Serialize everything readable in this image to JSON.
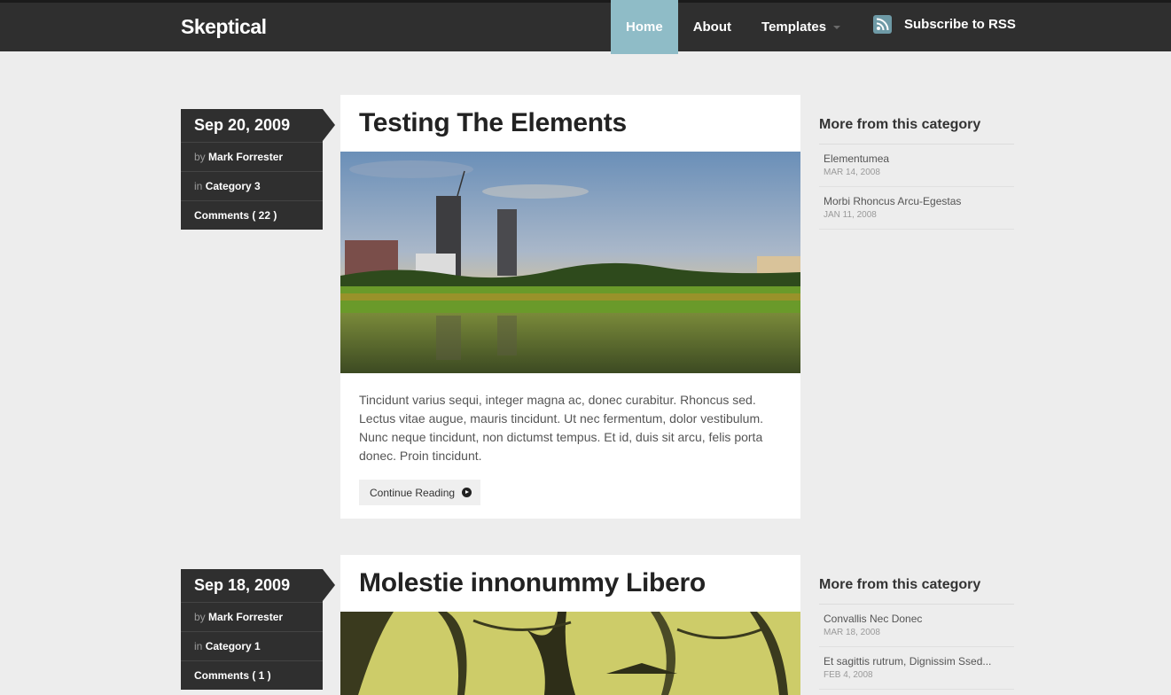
{
  "site": {
    "logo": "Skeptical"
  },
  "nav": {
    "items": [
      {
        "label": "Home",
        "active": true
      },
      {
        "label": "About",
        "active": false
      },
      {
        "label": "Templates",
        "active": false,
        "dropdown": true
      }
    ],
    "rss_label": "Subscribe to RSS"
  },
  "posts": [
    {
      "date": "Sep 20, 2009",
      "by_prefix": "by",
      "author": "Mark Forrester",
      "in_prefix": "in",
      "category": "Category 3",
      "comments": "Comments ( 22 )",
      "title": "Testing The Elements",
      "excerpt": "Tincidunt varius sequi, integer magna ac, donec curabitur. Rhoncus sed. Lectus vitae augue, mauris tincidunt. Ut nec fermentum, dolor vestibulum. Nunc neque tincidunt, non dictumst tempus. Et id, duis sit arcu, felis porta donec. Proin tincidunt.",
      "continue_label": "Continue Reading",
      "sidebar": {
        "title": "More from this category",
        "items": [
          {
            "title": "Elementumea",
            "date": "MAR 14, 2008"
          },
          {
            "title": "Morbi Rhoncus Arcu-Egestas",
            "date": "JAN 11, 2008"
          }
        ]
      }
    },
    {
      "date": "Sep 18, 2009",
      "by_prefix": "by",
      "author": "Mark Forrester",
      "in_prefix": "in",
      "category": "Category 1",
      "comments": "Comments ( 1 )",
      "title": "Molestie innonummy Libero",
      "sidebar": {
        "title": "More from this category",
        "items": [
          {
            "title": "Convallis Nec Donec",
            "date": "MAR 18, 2008"
          },
          {
            "title": "Et sagittis rutrum, Dignissim Ssed...",
            "date": "FEB 4, 2008"
          }
        ]
      }
    }
  ],
  "colors": {
    "header_bg": "#2f2f2f",
    "nav_active": "#8fbcc7",
    "page_bg": "#ededed"
  }
}
